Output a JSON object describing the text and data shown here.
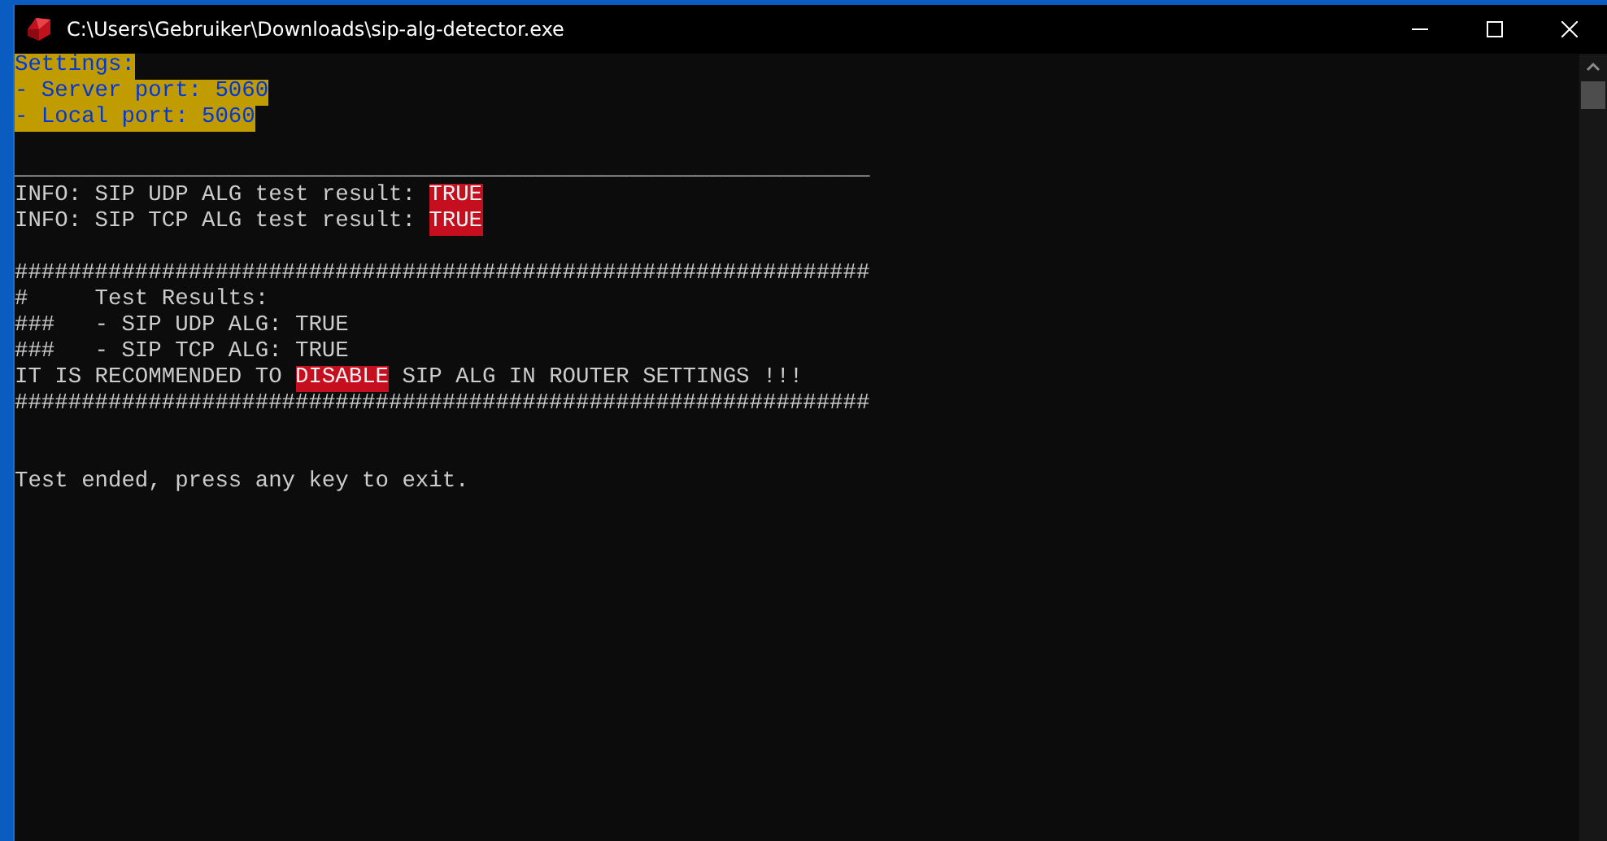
{
  "window": {
    "title": "C:\\Users\\Gebruiker\\Downloads\\sip-alg-detector.exe"
  },
  "console": {
    "lines": [
      {
        "kind": "text",
        "segments": [
          {
            "text": "Settings:",
            "color": "#c19c00"
          }
        ]
      },
      {
        "kind": "text",
        "segments": [
          {
            "text": "- Server port: 5060",
            "color": "#c19c00"
          }
        ]
      },
      {
        "kind": "text",
        "segments": [
          {
            "text": "- Local port: 5060",
            "color": "#c19c00"
          }
        ]
      },
      {
        "kind": "blank"
      },
      {
        "kind": "text",
        "segments": [
          {
            "text": "________________________________________________________________"
          }
        ]
      },
      {
        "kind": "text",
        "segments": [
          {
            "text": "INFO: SIP UDP ALG test result: "
          },
          {
            "text": "TRUE",
            "color": "#c50f1f"
          }
        ]
      },
      {
        "kind": "text",
        "segments": [
          {
            "text": "INFO: SIP TCP ALG test result: "
          },
          {
            "text": "TRUE",
            "color": "#c50f1f"
          }
        ]
      },
      {
        "kind": "blank"
      },
      {
        "kind": "text",
        "segments": [
          {
            "text": "################################################################"
          }
        ]
      },
      {
        "kind": "text",
        "segments": [
          {
            "text": "#     Test Results:"
          }
        ]
      },
      {
        "kind": "text",
        "segments": [
          {
            "text": "###   - SIP UDP ALG: TRUE"
          }
        ]
      },
      {
        "kind": "text",
        "segments": [
          {
            "text": "###   - SIP TCP ALG: TRUE"
          }
        ]
      },
      {
        "kind": "text",
        "segments": [
          {
            "text": "IT IS RECOMMENDED TO "
          },
          {
            "text": "DISABLE",
            "color": "#c50f1f"
          },
          {
            "text": " SIP ALG IN ROUTER SETTINGS !!!"
          }
        ]
      },
      {
        "kind": "text",
        "segments": [
          {
            "text": "################################################################"
          }
        ]
      },
      {
        "kind": "blank"
      },
      {
        "kind": "blank"
      },
      {
        "kind": "text",
        "segments": [
          {
            "text": "Test ended, press any key to exit."
          }
        ]
      }
    ]
  }
}
